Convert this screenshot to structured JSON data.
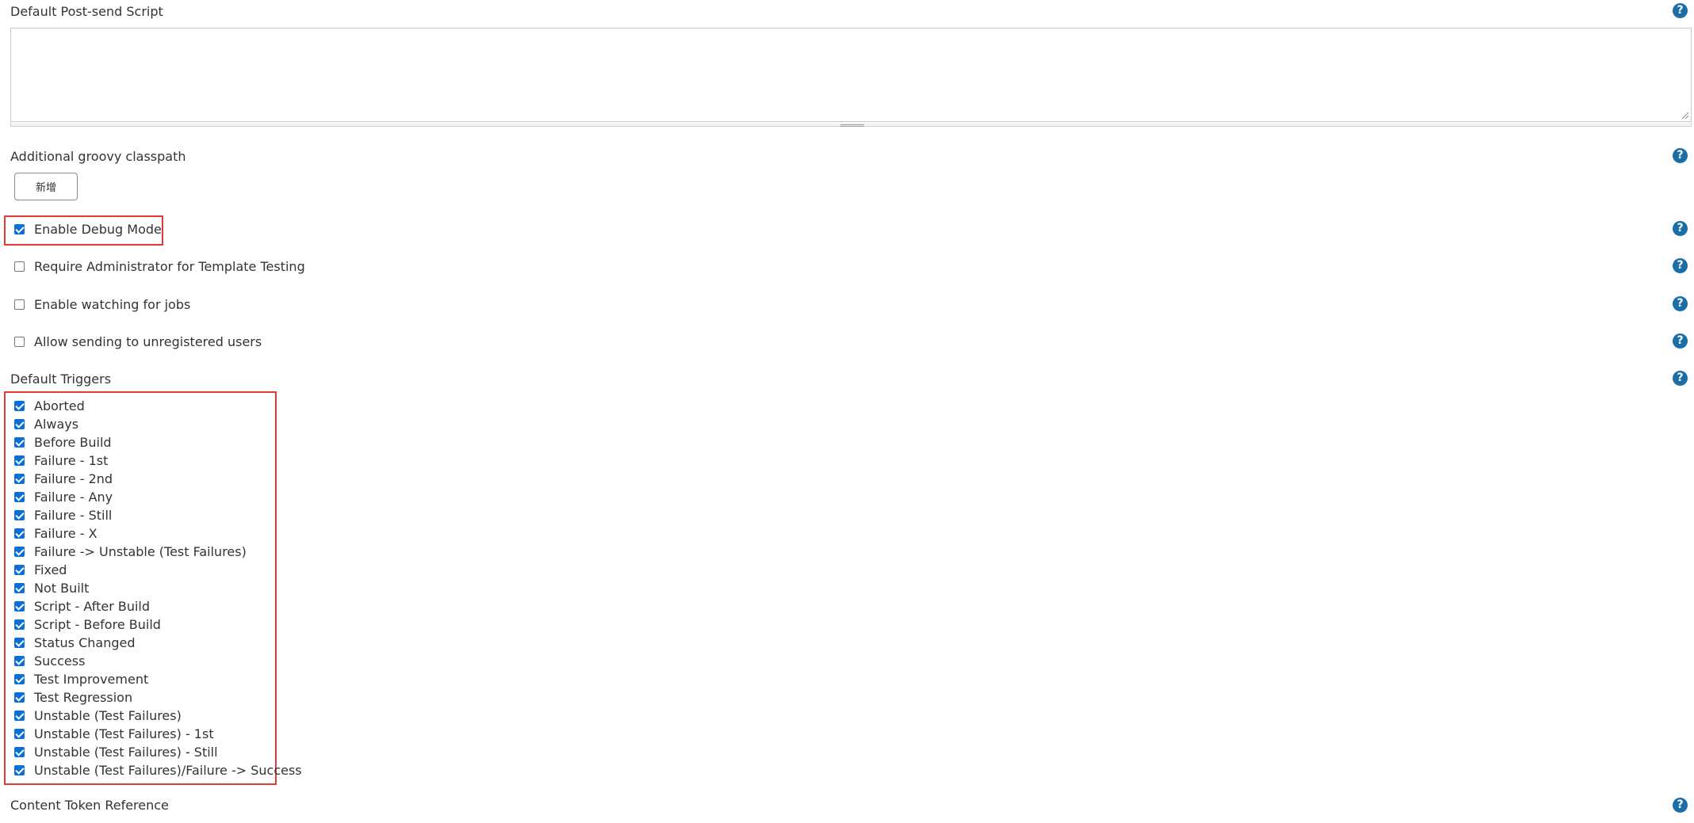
{
  "post_send_script": {
    "label": "Default Post-send Script",
    "value": ""
  },
  "groovy_classpath": {
    "label": "Additional groovy classpath",
    "add_button": "新增"
  },
  "options": [
    {
      "label": "Enable Debug Mode",
      "checked": true
    },
    {
      "label": "Require Administrator for Template Testing",
      "checked": false
    },
    {
      "label": "Enable watching for jobs",
      "checked": false
    },
    {
      "label": "Allow sending to unregistered users",
      "checked": false
    }
  ],
  "default_triggers": {
    "label": "Default Triggers",
    "items": [
      {
        "label": "Aborted",
        "checked": true
      },
      {
        "label": "Always",
        "checked": true
      },
      {
        "label": "Before Build",
        "checked": true
      },
      {
        "label": "Failure - 1st",
        "checked": true
      },
      {
        "label": "Failure - 2nd",
        "checked": true
      },
      {
        "label": "Failure - Any",
        "checked": true
      },
      {
        "label": "Failure - Still",
        "checked": true
      },
      {
        "label": "Failure - X",
        "checked": true
      },
      {
        "label": "Failure -> Unstable (Test Failures)",
        "checked": true
      },
      {
        "label": "Fixed",
        "checked": true
      },
      {
        "label": "Not Built",
        "checked": true
      },
      {
        "label": "Script - After Build",
        "checked": true
      },
      {
        "label": "Script - Before Build",
        "checked": true
      },
      {
        "label": "Status Changed",
        "checked": true
      },
      {
        "label": "Success",
        "checked": true
      },
      {
        "label": "Test Improvement",
        "checked": true
      },
      {
        "label": "Test Regression",
        "checked": true
      },
      {
        "label": "Unstable (Test Failures)",
        "checked": true
      },
      {
        "label": "Unstable (Test Failures) - 1st",
        "checked": true
      },
      {
        "label": "Unstable (Test Failures) - Still",
        "checked": true
      },
      {
        "label": "Unstable (Test Failures)/Failure -> Success",
        "checked": true
      }
    ]
  },
  "content_token": {
    "label": "Content Token Reference"
  },
  "help_glyph": "?",
  "colors": {
    "help_icon": "#1a6ea8",
    "checkbox_checked": "#0a6fd8",
    "highlight_box": "#e53935"
  }
}
